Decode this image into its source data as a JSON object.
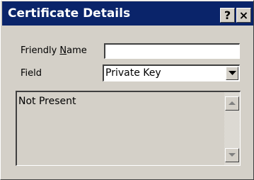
{
  "window": {
    "title": "Certificate Details",
    "help_label": "?",
    "close_label": "×"
  },
  "form": {
    "friendly_name_label_prefix": "Friendly ",
    "friendly_name_label_mnemonic": "N",
    "friendly_name_label_suffix": "ame",
    "friendly_name_value": "",
    "field_label": "Field",
    "field_selected": "Private Key"
  },
  "details": {
    "text": "Not Present"
  },
  "icons": {
    "dropdown": "chevron-down-icon",
    "scroll_up": "scroll-up-arrow-icon",
    "scroll_down": "scroll-down-arrow-icon"
  },
  "colors": {
    "titlebar": "#0a246a",
    "face": "#d4d0c8"
  }
}
